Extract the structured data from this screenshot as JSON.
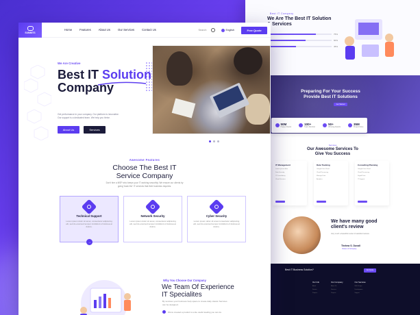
{
  "nav": {
    "logo_text": "SUMMITS",
    "links": [
      "Home",
      "Features",
      "About Us",
      "Our Services",
      "Contact Us"
    ],
    "search_label": "Search",
    "language": "English",
    "cta": "Free Quote"
  },
  "hero": {
    "kicker": "We Are Creative",
    "title_line1": "Best IT ",
    "title_accent": "Solution",
    "title_line2": "Company",
    "description": "Get performance in your company. Our platform is innovative. Our support is a dedicated team. We help you thrive.",
    "btn_about": "About Us",
    "btn_services": "Services"
  },
  "features": {
    "kicker": "Awesome Features",
    "title_line1": "Choose The Best IT",
    "title_line2": "Service Company",
    "description": "Don't hire a MSP who keeps your IT working smoothly. We ensure our clients by going 'back the' IT services that their business requires.",
    "cards": [
      {
        "title": "Technical Support",
        "text": "Lorem ipsum dolor sit amet, consectetur adipiscing elit, sed do eiusmod tempor incididunt of dolorea at dolore."
      },
      {
        "title": "Network Security",
        "text": "Lorem ipsum dolor sit amet, consectetur adipiscing elit, sed do eiusmod tempor incididunt of dolorea at dolore."
      },
      {
        "title": "Cyber Security",
        "text": "Lorem ipsum dolor sit amet consectetur adipiscing elit, sed do eiusmod tempor incididunt of dolorea at dolore."
      }
    ]
  },
  "why": {
    "kicker": "Why You Choose Our Company",
    "title_line1": "We Team Of Experience",
    "title_line2": "IT Specialites",
    "description": "By services your business help space to create daily classic Services can be designed.",
    "bullet": "We've created a product to unite useful leading you can do."
  },
  "back_page": {
    "section1_kicker": "Best IT Company",
    "section1_title": "We Are The Best IT Solution & Services",
    "bars": [
      0.75,
      0.6,
      0.45
    ],
    "bar_labels": [
      "75%",
      "60%",
      "45%"
    ],
    "hero_title_line1": "Preparing For Your Success",
    "hero_title_line2": "Provide Best IT Solutions",
    "hero_btn": "Get Started",
    "stats": [
      {
        "num": "50M",
        "label": "Happy Clients"
      },
      {
        "num": "100+",
        "label": "Team Member"
      },
      {
        "num": "50+",
        "label": "Winning Awards"
      },
      {
        "num": "35M",
        "label": "Project Done"
      }
    ],
    "services_kicker": "Services",
    "services_title_line1": "Our Awesome Services To",
    "services_title_line2": "Give You Success",
    "service_cards": [
      {
        "title": "IT Management",
        "items": [
          "Lorem ipsum dolor",
          "Data Security",
          "IT Consultancy",
          "Cloud Services"
        ]
      },
      {
        "title": "Data Tracking",
        "items": [
          "Google Data Cloud",
          "Cloud Processing",
          "Manage Data",
          "Analytics"
        ]
      },
      {
        "title": "Consulting Planning",
        "items": [
          "Google Data Cloud",
          "Cloud Processing",
          "Digital Data",
          "IT Support"
        ]
      }
    ],
    "testimonial_title_line1": "We have many good",
    "testimonial_title_line2": "client's review",
    "testimonial_text": "Very much a beautiful review of satisfied reviews",
    "testimonial_name": "Thelma S. Duvall",
    "testimonial_role": "Owner of Company",
    "footer_question": "Best IT Business Solution?",
    "footer_btn": "Get Quote",
    "footer_cols": [
      {
        "head": "Our Info",
        "items": [
          "About",
          "Service",
          "Projects"
        ]
      },
      {
        "head": "Our Company",
        "items": [
          "About Us",
          "Services",
          "Projects"
        ]
      },
      {
        "head": "Our Services",
        "items": [
          "Web Design",
          "Development",
          "Support"
        ]
      }
    ]
  },
  "colors": {
    "accent": "#5b3cf0",
    "dark": "#1b1b3a"
  }
}
